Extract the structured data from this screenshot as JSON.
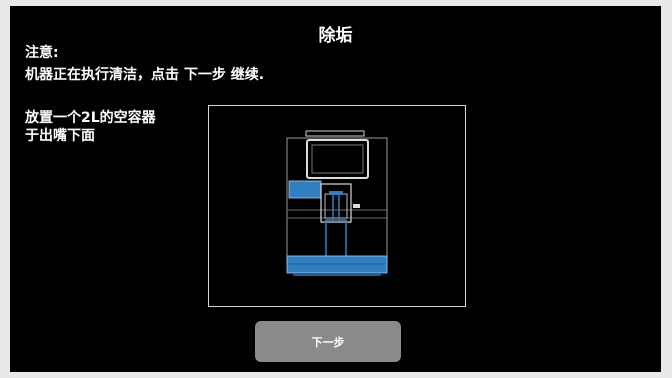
{
  "screen": {
    "title": "除垢",
    "notice_heading": "注意:",
    "notice_text": "机器正在执行清洁，点击 下一步 继续.",
    "instruction_lines": [
      "放置一个2L的空容器",
      "于出嘴下面"
    ],
    "illustration_icon": "coffee-machine-with-container-icon",
    "next_button_label": "下一步"
  },
  "colors": {
    "background": "#000000",
    "highlight_blue": "#2f7fc1",
    "button_gray": "#8a8a8a"
  }
}
